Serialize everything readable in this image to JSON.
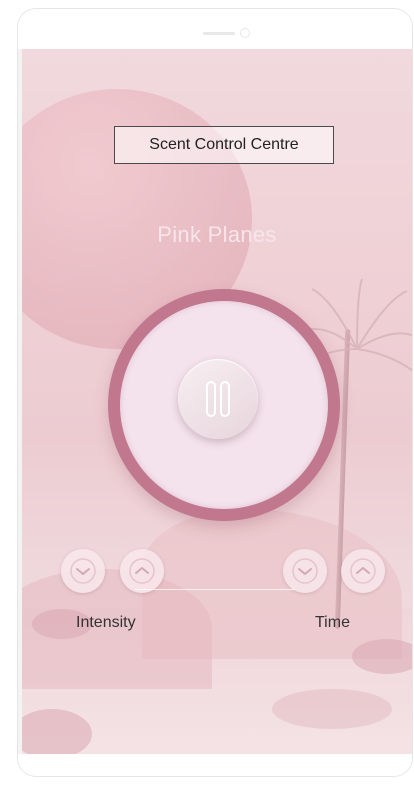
{
  "header": {
    "title": "Scent Control Centre"
  },
  "player": {
    "scent_name": "Pink Planes",
    "state": "playing",
    "play_pause_icon": "pause-icon"
  },
  "controls": {
    "intensity": {
      "label": "Intensity",
      "decrease_icon": "chevron-down-icon",
      "increase_icon": "chevron-up-icon"
    },
    "time": {
      "label": "Time",
      "decrease_icon": "chevron-down-icon",
      "increase_icon": "chevron-up-icon"
    }
  },
  "colors": {
    "dial_ring": "#c1778e",
    "dial_face": "#f4e2ec",
    "background_tint": "#efd1d6"
  }
}
